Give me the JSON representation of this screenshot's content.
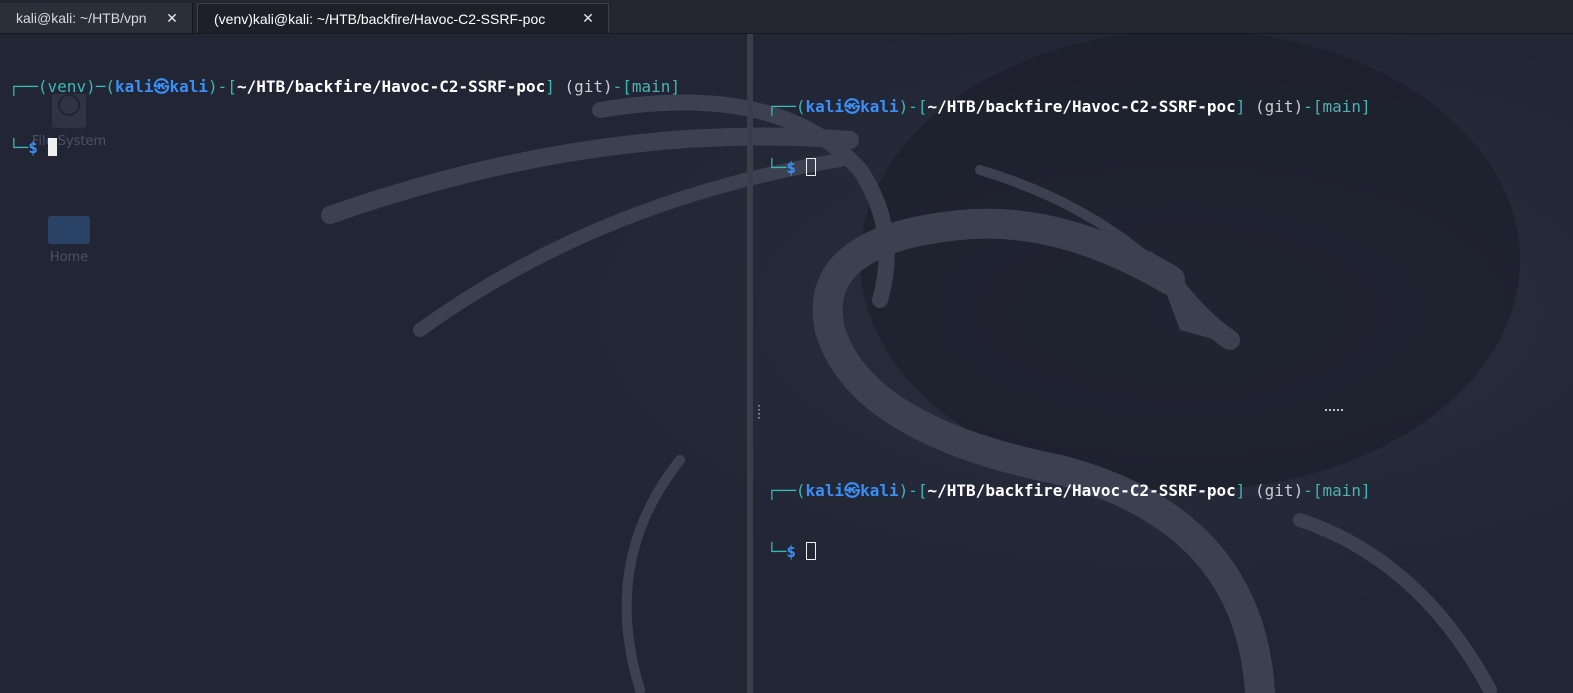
{
  "desktop": {
    "icons": [
      {
        "label": "File System",
        "icon": "drive-icon"
      },
      {
        "label": "Home",
        "icon": "home-folder-icon"
      }
    ]
  },
  "tabs": [
    {
      "title": "kali@kali: ~/HTB/vpn",
      "close": "✕",
      "active": false
    },
    {
      "title": "(venv)kali@kali: ~/HTB/backfire/Havoc-C2-SSRF-poc",
      "close": "✕",
      "active": true
    }
  ],
  "panes": {
    "left": {
      "frame_top": "┌──",
      "venv": "(venv)",
      "sep1": "─(",
      "user": "kali㉿kali",
      "sep2": ")-[",
      "path": "~/HTB/backfire/Havoc-C2-SSRF-poc",
      "sep3": "] ",
      "git": "(git)",
      "sep4": "-[",
      "branch": "main",
      "sep5": "]",
      "frame_bottom": "└─",
      "prompt": "$ "
    },
    "right_top": {
      "frame_top": "┌──(",
      "user": "kali㉿kali",
      "sep2": ")-[",
      "path": "~/HTB/backfire/Havoc-C2-SSRF-poc",
      "sep3": "] ",
      "git": "(git)",
      "sep4": "-[",
      "branch": "main",
      "sep5": "]",
      "frame_bottom": "└─",
      "prompt": "$ "
    },
    "right_bottom": {
      "frame_top": "┌──(",
      "user": "kali㉿kali",
      "sep2": ")-[",
      "path": "~/HTB/backfire/Havoc-C2-SSRF-poc",
      "sep3": "] ",
      "git": "(git)",
      "sep4": "-[",
      "branch": "main",
      "sep5": "]",
      "frame_bottom": "└─",
      "prompt": "$ "
    }
  },
  "colors": {
    "background": "#212534",
    "prompt_frame": "#3ab7b4",
    "user": "#3a8ff5",
    "path": "#ffffff",
    "branch": "#4fb2b0"
  }
}
